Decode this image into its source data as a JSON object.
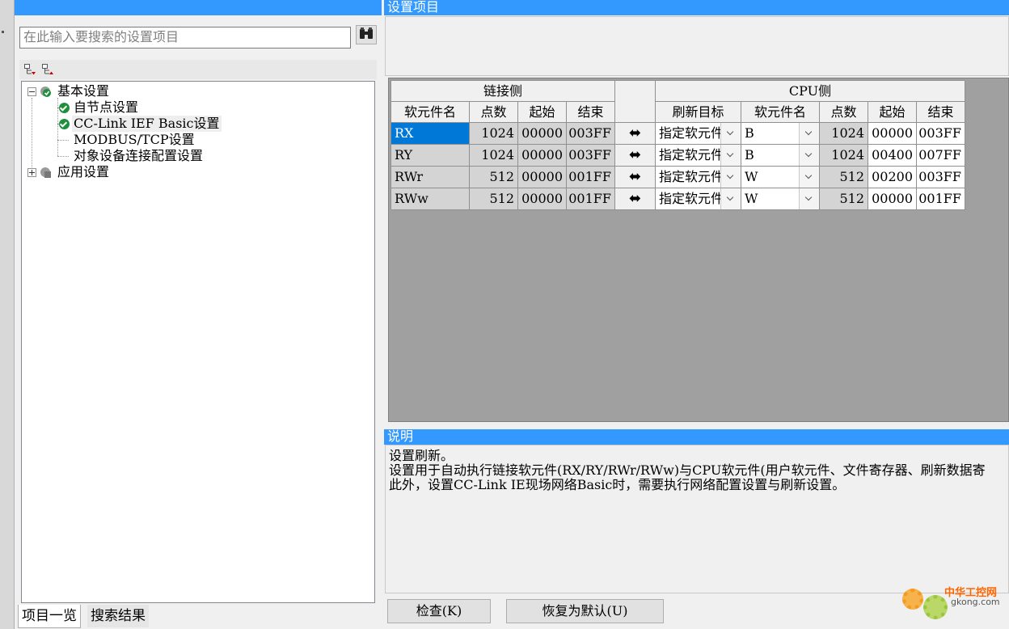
{
  "left": {
    "search_placeholder": "在此输入要搜索的设置项目",
    "tree": [
      {
        "label": "基本设置"
      },
      {
        "label": "自节点设置"
      },
      {
        "label": "CC-Link IEF Basic设置"
      },
      {
        "label": "MODBUS/TCP设置"
      },
      {
        "label": "对象设备连接配置设置"
      },
      {
        "label": "应用设置"
      }
    ],
    "tabs": [
      "项目一览",
      "搜索结果"
    ]
  },
  "right": {
    "title": "设置项目",
    "table": {
      "group_link": "链接侧",
      "group_cpu": "CPU侧",
      "headers": [
        "软元件名",
        "点数",
        "起始",
        "结束",
        "刷新目标",
        "软元件名",
        "点数",
        "起始",
        "结束"
      ],
      "rows": [
        {
          "dev": "RX",
          "pts": "1024",
          "start": "00000",
          "end": "003FF",
          "target": "指定软元件",
          "cpu_dev": "B",
          "cpu_pts": "1024",
          "cpu_start": "00000",
          "cpu_end": "003FF"
        },
        {
          "dev": "RY",
          "pts": "1024",
          "start": "00000",
          "end": "003FF",
          "target": "指定软元件",
          "cpu_dev": "B",
          "cpu_pts": "1024",
          "cpu_start": "00400",
          "cpu_end": "007FF"
        },
        {
          "dev": "RWr",
          "pts": "512",
          "start": "00000",
          "end": "001FF",
          "target": "指定软元件",
          "cpu_dev": "W",
          "cpu_pts": "512",
          "cpu_start": "00200",
          "cpu_end": "003FF"
        },
        {
          "dev": "RWw",
          "pts": "512",
          "start": "00000",
          "end": "001FF",
          "target": "指定软元件",
          "cpu_dev": "W",
          "cpu_pts": "512",
          "cpu_start": "00000",
          "cpu_end": "001FF"
        }
      ],
      "arrow": "⬌"
    },
    "desc_title": "说明",
    "desc_lines": [
      "设置刷新。",
      "设置用于自动执行链接软元件(RX/RY/RWr/RWw)与CPU软元件(用户软元件、文件寄存器、刷新数据寄",
      "此外，设置CC-Link IE现场网络Basic时，需要执行网络配置设置与刷新设置。"
    ],
    "buttons": {
      "check": "检查(K)",
      "restore": "恢复为默认(U)"
    }
  },
  "watermark": {
    "line1": "中华工控网",
    "line2": "gkong.com"
  }
}
